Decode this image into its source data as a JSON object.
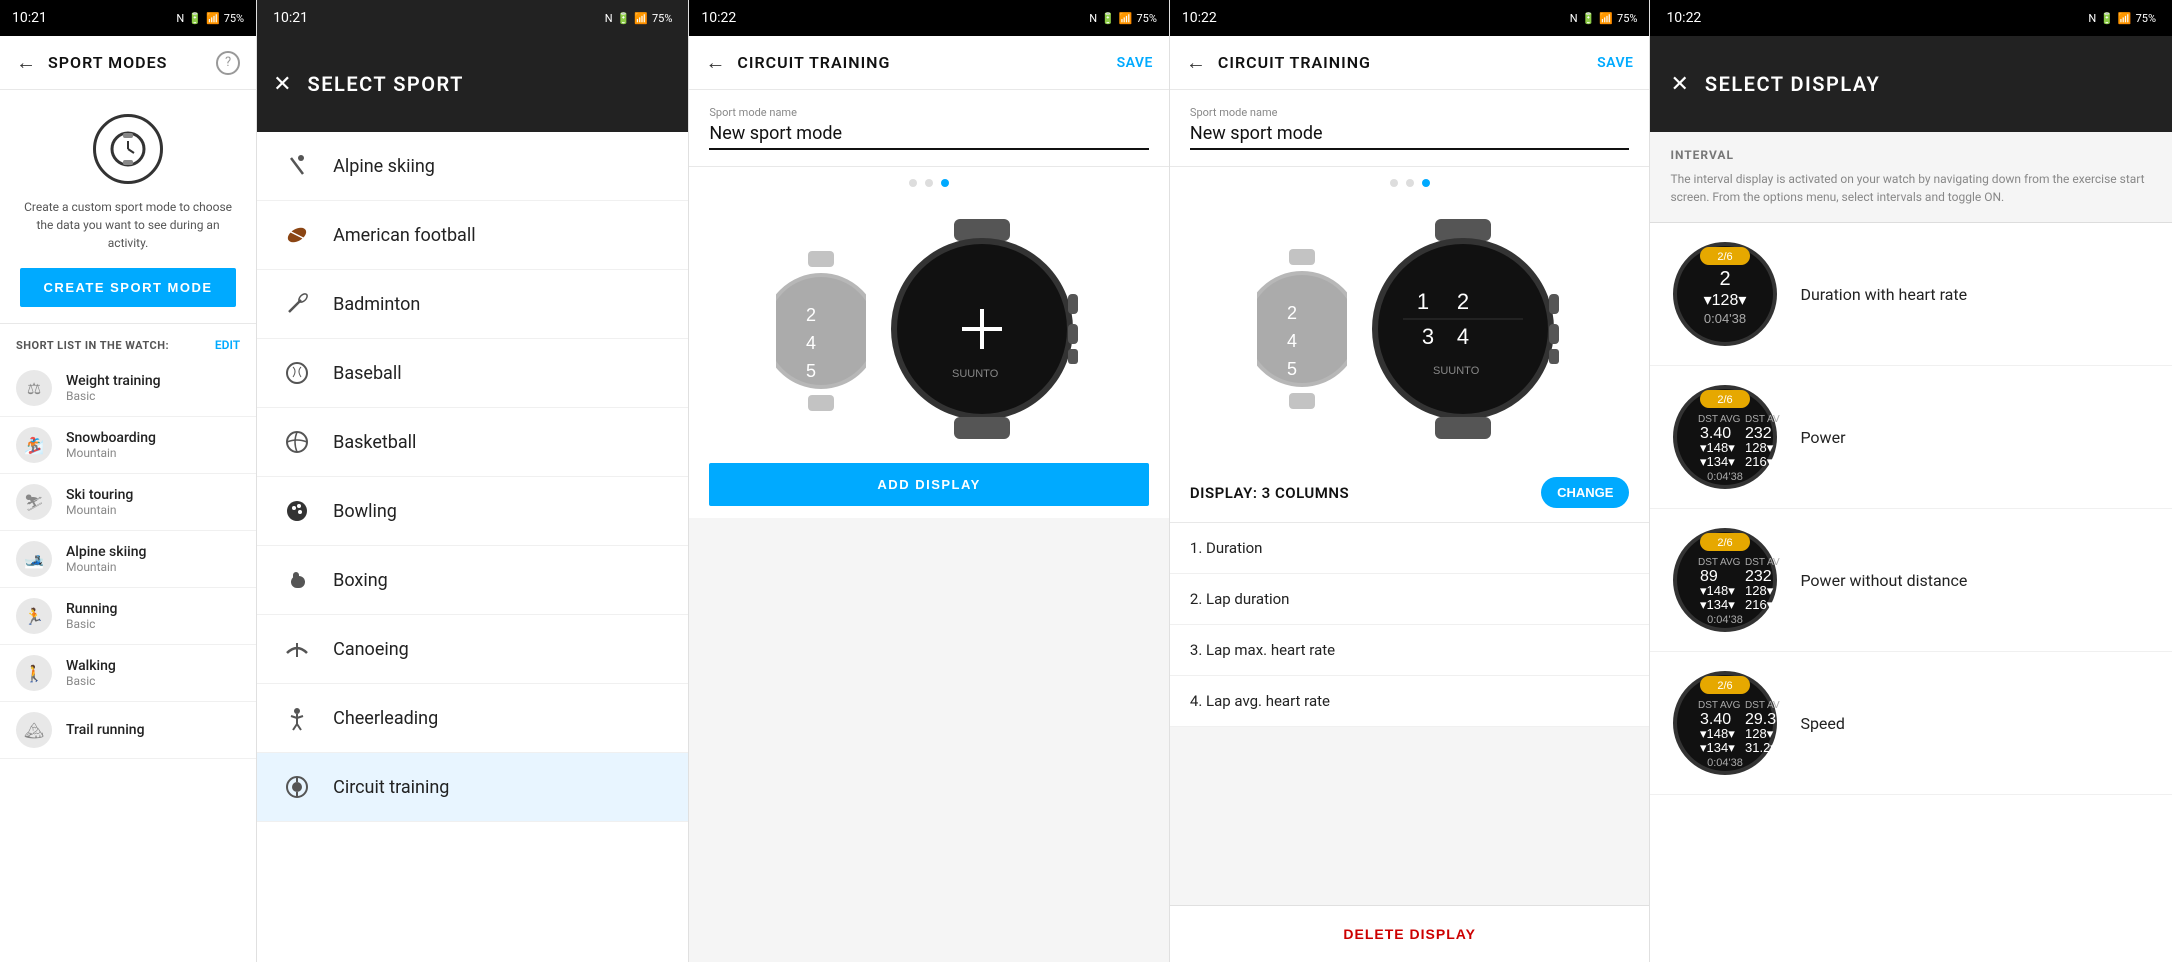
{
  "panel1": {
    "status": {
      "time": "10:21",
      "icons": "N ⚡ 📶 75%"
    },
    "nav": {
      "title": "SPORT MODES",
      "help_icon": "?"
    },
    "hero": {
      "description": "Create a custom sport mode to choose the data you want to see during an activity.",
      "create_btn_label": "CREATE SPORT MODE"
    },
    "list_header": {
      "label": "SHORT LIST IN THE WATCH:",
      "edit_label": "EDIT"
    },
    "sports": [
      {
        "name": "Weight training",
        "sub": "Basic",
        "icon": "⚖"
      },
      {
        "name": "Snowboarding",
        "sub": "Mountain",
        "icon": "🏂"
      },
      {
        "name": "Ski touring",
        "sub": "Mountain",
        "icon": "⛷"
      },
      {
        "name": "Alpine skiing",
        "sub": "Mountain",
        "icon": "🎿"
      },
      {
        "name": "Running",
        "sub": "Basic",
        "icon": "🏃"
      },
      {
        "name": "Walking",
        "sub": "Basic",
        "icon": "🚶"
      },
      {
        "name": "Trail running",
        "sub": "",
        "icon": "🏔"
      }
    ]
  },
  "panel2": {
    "status": {
      "time": "10:21",
      "icons": "N ⚡ 📶 75%"
    },
    "header": {
      "close_icon": "✕",
      "title": "SELECT SPORT"
    },
    "sports": [
      {
        "name": "Alpine skiing",
        "icon": "ski"
      },
      {
        "name": "American football",
        "icon": "football"
      },
      {
        "name": "Badminton",
        "icon": "badminton"
      },
      {
        "name": "Baseball",
        "icon": "baseball"
      },
      {
        "name": "Basketball",
        "icon": "basketball"
      },
      {
        "name": "Bowling",
        "icon": "bowling"
      },
      {
        "name": "Boxing",
        "icon": "boxing"
      },
      {
        "name": "Canoeing",
        "icon": "canoe"
      },
      {
        "name": "Cheerleading",
        "icon": "cheer"
      },
      {
        "name": "Circuit training",
        "icon": "circuit"
      }
    ]
  },
  "panel3": {
    "status": {
      "time": "10:22",
      "icons": "N ⚡ 📶 75%"
    },
    "nav": {
      "title": "CIRCUIT TRAINING",
      "save_label": "SAVE"
    },
    "field": {
      "label": "Sport mode name",
      "value": "New sport mode"
    },
    "dots": [
      false,
      false,
      true
    ],
    "add_display_label": "ADD DISPLAY"
  },
  "panel4": {
    "status": {
      "time": "10:22",
      "icons": "N ⚡ 📶 75%"
    },
    "nav": {
      "title": "CIRCUIT TRAINING",
      "save_label": "SAVE"
    },
    "field": {
      "label": "Sport mode name",
      "value": "New sport mode"
    },
    "dots": [
      false,
      false,
      true
    ],
    "display_section": {
      "label": "DISPLAY: 3 COLUMNS",
      "change_btn": "CHANGE"
    },
    "display_items": [
      "1. Duration",
      "2. Lap duration",
      "3. Lap max. heart rate",
      "4. Lap avg. heart rate"
    ],
    "delete_btn_label": "DELETE DISPLAY"
  },
  "panel5": {
    "status": {
      "time": "10:22",
      "icons": "N ⚡ 📶 75%"
    },
    "header": {
      "close_icon": "✕",
      "title": "SELECT DISPLAY"
    },
    "interval": {
      "label": "INTERVAL",
      "description": "The interval display is activated on your watch by navigating down from the exercise start screen. From the options menu, select intervals and toggle ON."
    },
    "display_options": [
      {
        "name": "Duration with heart rate",
        "badge": "2/6",
        "watch_lines": [
          "2",
          "▾128▾",
          "0:04'38"
        ]
      },
      {
        "name": "Power",
        "badge": "2/6",
        "watch_lines": [
          "3.40",
          "▾148▾",
          "0:04'38"
        ]
      },
      {
        "name": "Power without distance",
        "badge": "2/6",
        "watch_lines": [
          "89",
          "▾148▾",
          "0:04'38"
        ]
      },
      {
        "name": "Speed",
        "badge": "2/6",
        "watch_lines": [
          "3.40",
          "▾148▾",
          "0:04'38"
        ]
      }
    ]
  }
}
